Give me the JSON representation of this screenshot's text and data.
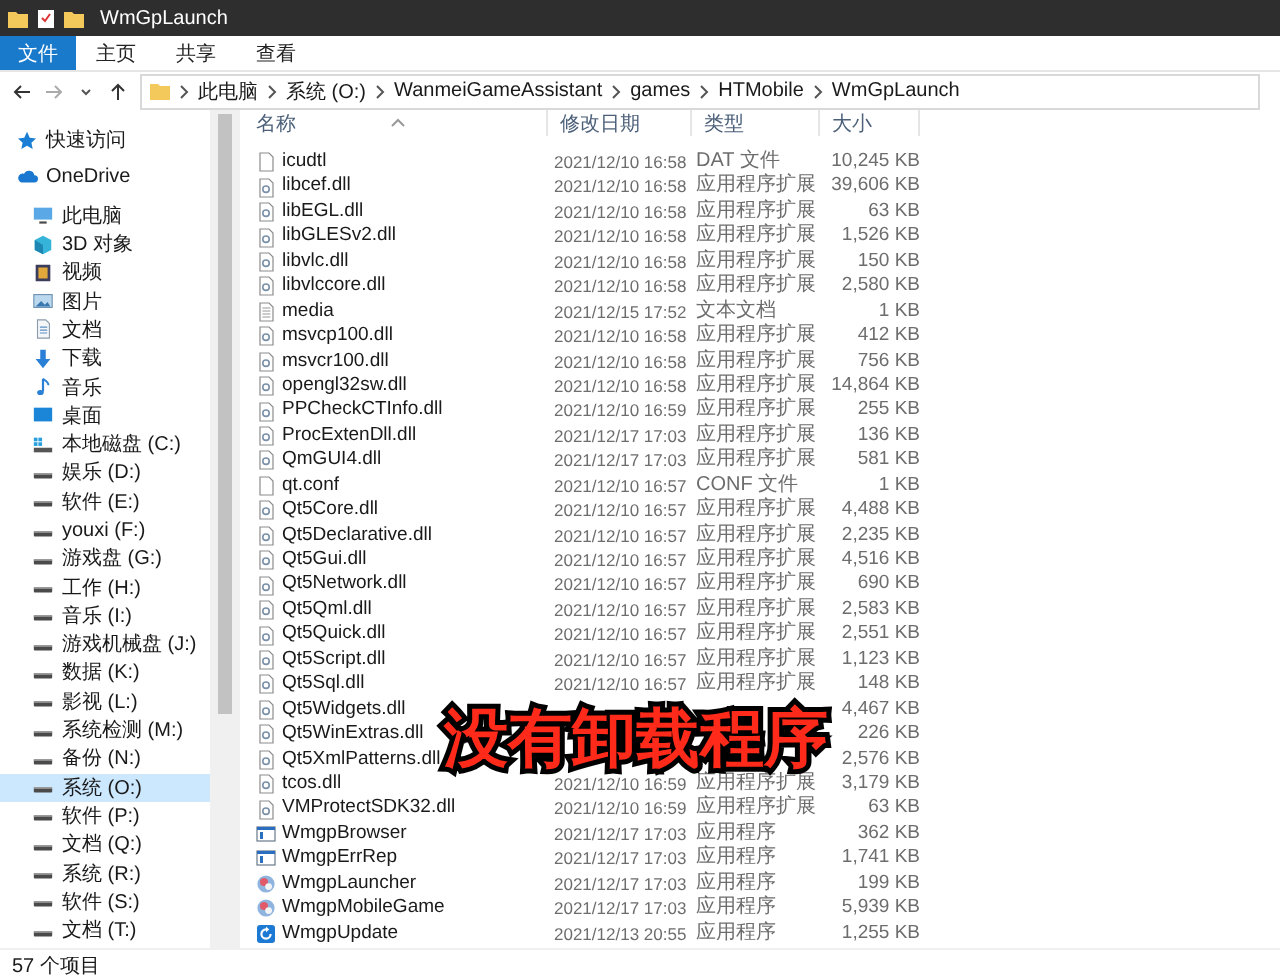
{
  "window": {
    "title": "WmGpLaunch"
  },
  "ribbon_tabs": [
    {
      "label": "文件",
      "kind": "file-menu"
    },
    {
      "label": "主页",
      "kind": "tab"
    },
    {
      "label": "共享",
      "kind": "tab"
    },
    {
      "label": "查看",
      "kind": "tab"
    }
  ],
  "address": [
    "此电脑",
    "系统 (O:)",
    "WanmeiGameAssistant",
    "games",
    "HTMobile",
    "WmGpLaunch"
  ],
  "sidebar": {
    "items": [
      {
        "label": "快速访问",
        "kind": "quick",
        "selected": false
      },
      {
        "label": "OneDrive",
        "kind": "cloud",
        "selected": false
      },
      {
        "label": "此电脑",
        "kind": "pc",
        "selected": false
      },
      {
        "label": "3D 对象",
        "kind": "cube",
        "selected": false
      },
      {
        "label": "视频",
        "kind": "video",
        "selected": false
      },
      {
        "label": "图片",
        "kind": "picture",
        "selected": false
      },
      {
        "label": "文档",
        "kind": "doc",
        "selected": false
      },
      {
        "label": "下载",
        "kind": "download",
        "selected": false
      },
      {
        "label": "音乐",
        "kind": "music",
        "selected": false
      },
      {
        "label": "桌面",
        "kind": "desktop",
        "selected": false
      },
      {
        "label": "本地磁盘 (C:)",
        "kind": "system-drive",
        "selected": false
      },
      {
        "label": "娱乐 (D:)",
        "kind": "drive",
        "selected": false
      },
      {
        "label": "软件 (E:)",
        "kind": "drive",
        "selected": false
      },
      {
        "label": "youxi (F:)",
        "kind": "drive",
        "selected": false
      },
      {
        "label": "游戏盘 (G:)",
        "kind": "drive",
        "selected": false
      },
      {
        "label": "工作 (H:)",
        "kind": "drive",
        "selected": false
      },
      {
        "label": "音乐 (I:)",
        "kind": "drive",
        "selected": false
      },
      {
        "label": "游戏机械盘 (J:)",
        "kind": "drive",
        "selected": false
      },
      {
        "label": "数据 (K:)",
        "kind": "drive",
        "selected": false
      },
      {
        "label": "影视 (L:)",
        "kind": "drive",
        "selected": false
      },
      {
        "label": "系统检测 (M:)",
        "kind": "drive",
        "selected": false
      },
      {
        "label": "备份 (N:)",
        "kind": "drive",
        "selected": false
      },
      {
        "label": "系统 (O:)",
        "kind": "drive",
        "selected": true
      },
      {
        "label": "软件 (P:)",
        "kind": "drive",
        "selected": false
      },
      {
        "label": "文档 (Q:)",
        "kind": "drive",
        "selected": false
      },
      {
        "label": "系统 (R:)",
        "kind": "drive",
        "selected": false
      },
      {
        "label": "软件 (S:)",
        "kind": "drive",
        "selected": false
      },
      {
        "label": "文档 (T:)",
        "kind": "drive",
        "selected": false
      }
    ]
  },
  "table": {
    "columns": [
      "名称",
      "修改日期",
      "类型",
      "大小"
    ],
    "rows": [
      {
        "name": "icudtl",
        "date": "2021/12/10 16:58",
        "type": "DAT 文件",
        "size": "10,245 KB",
        "kind": "file"
      },
      {
        "name": "libcef.dll",
        "date": "2021/12/10 16:58",
        "type": "应用程序扩展",
        "size": "39,606 KB",
        "kind": "dll"
      },
      {
        "name": "libEGL.dll",
        "date": "2021/12/10 16:58",
        "type": "应用程序扩展",
        "size": "63 KB",
        "kind": "dll"
      },
      {
        "name": "libGLESv2.dll",
        "date": "2021/12/10 16:58",
        "type": "应用程序扩展",
        "size": "1,526 KB",
        "kind": "dll"
      },
      {
        "name": "libvlc.dll",
        "date": "2021/12/10 16:58",
        "type": "应用程序扩展",
        "size": "150 KB",
        "kind": "dll"
      },
      {
        "name": "libvlccore.dll",
        "date": "2021/12/10 16:58",
        "type": "应用程序扩展",
        "size": "2,580 KB",
        "kind": "dll"
      },
      {
        "name": "media",
        "date": "2021/12/15 17:52",
        "type": "文本文档",
        "size": "1 KB",
        "kind": "text"
      },
      {
        "name": "msvcp100.dll",
        "date": "2021/12/10 16:58",
        "type": "应用程序扩展",
        "size": "412 KB",
        "kind": "dll"
      },
      {
        "name": "msvcr100.dll",
        "date": "2021/12/10 16:58",
        "type": "应用程序扩展",
        "size": "756 KB",
        "kind": "dll"
      },
      {
        "name": "opengl32sw.dll",
        "date": "2021/12/10 16:58",
        "type": "应用程序扩展",
        "size": "14,864 KB",
        "kind": "dll"
      },
      {
        "name": "PPCheckCTInfo.dll",
        "date": "2021/12/10 16:59",
        "type": "应用程序扩展",
        "size": "255 KB",
        "kind": "dll"
      },
      {
        "name": "ProcExtenDll.dll",
        "date": "2021/12/17 17:03",
        "type": "应用程序扩展",
        "size": "136 KB",
        "kind": "dll"
      },
      {
        "name": "QmGUI4.dll",
        "date": "2021/12/17 17:03",
        "type": "应用程序扩展",
        "size": "581 KB",
        "kind": "dll"
      },
      {
        "name": "qt.conf",
        "date": "2021/12/10 16:57",
        "type": "CONF 文件",
        "size": "1 KB",
        "kind": "file"
      },
      {
        "name": "Qt5Core.dll",
        "date": "2021/12/10 16:57",
        "type": "应用程序扩展",
        "size": "4,488 KB",
        "kind": "dll"
      },
      {
        "name": "Qt5Declarative.dll",
        "date": "2021/12/10 16:57",
        "type": "应用程序扩展",
        "size": "2,235 KB",
        "kind": "dll"
      },
      {
        "name": "Qt5Gui.dll",
        "date": "2021/12/10 16:57",
        "type": "应用程序扩展",
        "size": "4,516 KB",
        "kind": "dll"
      },
      {
        "name": "Qt5Network.dll",
        "date": "2021/12/10 16:57",
        "type": "应用程序扩展",
        "size": "690 KB",
        "kind": "dll"
      },
      {
        "name": "Qt5Qml.dll",
        "date": "2021/12/10 16:57",
        "type": "应用程序扩展",
        "size": "2,583 KB",
        "kind": "dll"
      },
      {
        "name": "Qt5Quick.dll",
        "date": "2021/12/10 16:57",
        "type": "应用程序扩展",
        "size": "2,551 KB",
        "kind": "dll"
      },
      {
        "name": "Qt5Script.dll",
        "date": "2021/12/10 16:57",
        "type": "应用程序扩展",
        "size": "1,123 KB",
        "kind": "dll"
      },
      {
        "name": "Qt5Sql.dll",
        "date": "2021/12/10 16:57",
        "type": "应用程序扩展",
        "size": "148 KB",
        "kind": "dll"
      },
      {
        "name": "Qt5Widgets.dll",
        "size": "4,467 KB",
        "kind": "dll"
      },
      {
        "name": "Qt5WinExtras.dll",
        "size": "226 KB",
        "kind": "dll"
      },
      {
        "name": "Qt5XmlPatterns.dll",
        "size": "2,576 KB",
        "kind": "dll"
      },
      {
        "name": "tcos.dll",
        "date": "2021/12/10 16:59",
        "type": "应用程序扩展",
        "size": "3,179 KB",
        "kind": "dll"
      },
      {
        "name": "VMProtectSDK32.dll",
        "date": "2021/12/10 16:59",
        "type": "应用程序扩展",
        "size": "63 KB",
        "kind": "dll"
      },
      {
        "name": "WmgpBrowser",
        "date": "2021/12/17 17:03",
        "type": "应用程序",
        "size": "362 KB",
        "kind": "exe-window"
      },
      {
        "name": "WmgpErrRep",
        "date": "2021/12/17 17:03",
        "type": "应用程序",
        "size": "1,741 KB",
        "kind": "exe-window"
      },
      {
        "name": "WmgpLauncher",
        "date": "2021/12/17 17:03",
        "type": "应用程序",
        "size": "199 KB",
        "kind": "exe-app"
      },
      {
        "name": "WmgpMobileGame",
        "date": "2021/12/17 17:03",
        "type": "应用程序",
        "size": "5,939 KB",
        "kind": "exe-app"
      },
      {
        "name": "WmgpUpdate",
        "date": "2021/12/13 20:55",
        "type": "应用程序",
        "size": "1,255 KB",
        "kind": "exe-update"
      }
    ]
  },
  "overlay_caption": "没有卸载程序",
  "status_bar": "57 个项目"
}
